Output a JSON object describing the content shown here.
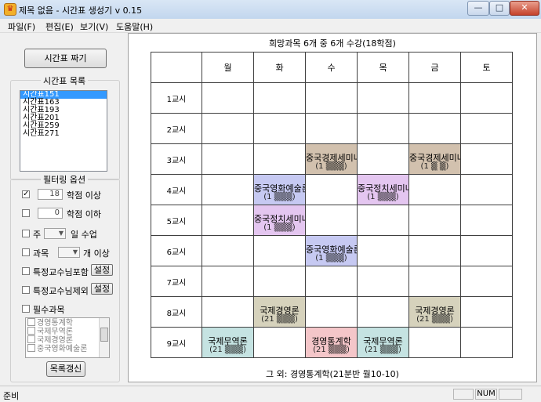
{
  "window": {
    "title": "제목 없음 - 시간표 생성기 v 0.15",
    "app_icon_glyph": "♛",
    "buttons": {
      "minimize": "—",
      "maximize": "□",
      "close": "✕"
    }
  },
  "menu": [
    "파일(F)",
    "편집(E)",
    "보기(V)",
    "도움말(H)"
  ],
  "left": {
    "generate_button": "시간표 짜기",
    "list_title": "시간표 목록",
    "timetables": [
      "시간표151",
      "시간표163",
      "시간표193",
      "시간표201",
      "시간표259",
      "시간표271"
    ],
    "selected_index": 0,
    "filter_title": "필터링 옵션",
    "filters": {
      "min_credits": {
        "checked": true,
        "value": "18",
        "label": "학점 이상"
      },
      "max_credits": {
        "checked": false,
        "value": "0",
        "label": "학점 이하"
      },
      "days_per_week": {
        "checked": false,
        "prefix": "주",
        "label": "일 수업"
      },
      "courses_per_day": {
        "checked": false,
        "prefix": "과목",
        "label": "개 이상"
      },
      "include_prof": {
        "checked": false,
        "label": "특정교수님포함",
        "button": "설정"
      },
      "exclude_prof": {
        "checked": false,
        "label": "특정교수님제외",
        "button": "설정"
      },
      "required": {
        "checked": false,
        "label": "필수과목"
      }
    },
    "required_courses": [
      "경영통계학",
      "국제무역론",
      "국제경영론",
      "중국영화예술론"
    ],
    "refresh_button": "목록갱신"
  },
  "main": {
    "summary": "희망과목 6개 중 6개 수강(18학점)",
    "days": [
      "월",
      "화",
      "수",
      "목",
      "금",
      "토"
    ],
    "periods": [
      "1교시",
      "2교시",
      "3교시",
      "4교시",
      "5교시",
      "6교시",
      "7교시",
      "8교시",
      "9교시"
    ],
    "cells": [
      {
        "period": 2,
        "day": 2,
        "name": "중국경제세미나",
        "sub": "(1 ▒▒▒)",
        "color": "tan"
      },
      {
        "period": 2,
        "day": 4,
        "name": "중국경제세미나",
        "sub": "(1 ▒ ▒)",
        "color": "tan"
      },
      {
        "period": 3,
        "day": 1,
        "name": "중국영화예술론",
        "sub": "(1 ▒▒▒)",
        "color": "blue"
      },
      {
        "period": 3,
        "day": 3,
        "name": "중국정치세미나",
        "sub": "(1 ▒▒▒)",
        "color": "purple"
      },
      {
        "period": 4,
        "day": 1,
        "name": "중국정치세미나",
        "sub": "(1 ▒▒▒)",
        "color": "purple"
      },
      {
        "period": 5,
        "day": 2,
        "name": "중국영화예술론",
        "sub": "(1 ▒▒▒)",
        "color": "blue"
      },
      {
        "period": 7,
        "day": 1,
        "name": "국제경영론",
        "sub": "(21 ▒▒▒)",
        "color": "olive"
      },
      {
        "period": 7,
        "day": 4,
        "name": "국제경영론",
        "sub": "(21 ▒▒▒)",
        "color": "olive"
      },
      {
        "period": 8,
        "day": 0,
        "name": "국제무역론",
        "sub": "(21 ▒▒▒)",
        "color": "teal"
      },
      {
        "period": 8,
        "day": 2,
        "name": "경영통계학",
        "sub": "(21 ▒▒▒)",
        "color": "pink"
      },
      {
        "period": 8,
        "day": 3,
        "name": "국제무역론",
        "sub": "(21 ▒▒▒)",
        "color": "teal"
      }
    ],
    "footer": "그 외: 경영통계학(21분반 월10-10)"
  },
  "status": {
    "text": "준비",
    "num": "NUM"
  },
  "colors": {
    "tan": "#d2c1ae",
    "blue": "#c6c9f2",
    "purple": "#e4c6f0",
    "olive": "#d6d2bc",
    "teal": "#c5e3e2",
    "pink": "#f4c6c9"
  }
}
